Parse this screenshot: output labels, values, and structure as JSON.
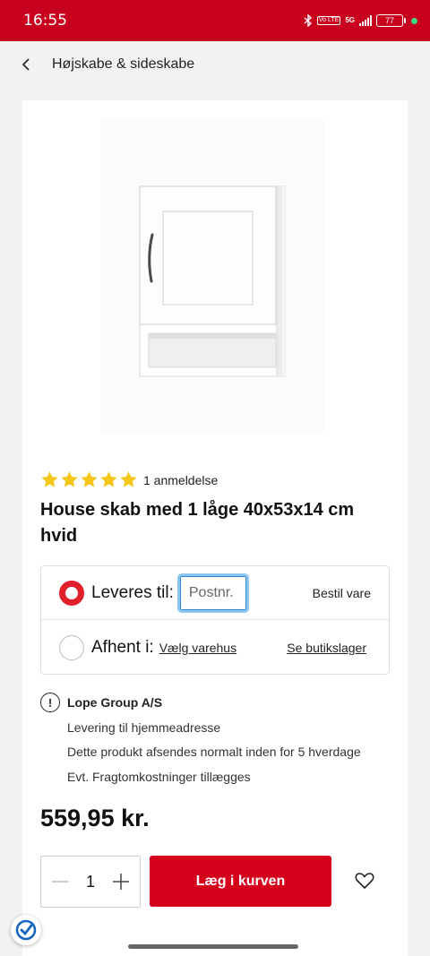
{
  "status_bar": {
    "time": "16:55",
    "volte_label": "Vo LTE",
    "network_label": "5G",
    "battery": "77"
  },
  "nav": {
    "title": "Højskabe & sideskabe",
    "back_icon": "chevron-left-icon"
  },
  "product": {
    "rating_stars": 5,
    "review_count": "1 anmeldelse",
    "title": "House skab med 1 låge 40x53x14 cm hvid"
  },
  "delivery": {
    "deliver_label": "Leveres til:",
    "postnr_placeholder": "Postnr.",
    "postnr_value": "",
    "order_text": "Bestil vare",
    "pickup_label": "Afhent i:",
    "choose_store": "Vælg varehus",
    "store_stock": "Se butikslager"
  },
  "seller": {
    "name": "Lope Group A/S",
    "lines": [
      "Levering til hjemmeadresse",
      "Dette produkt afsendes normalt inden for 5 hverdage",
      "Evt. Fragtomkostninger tillægges"
    ]
  },
  "price": "559,95 kr.",
  "cart": {
    "quantity": "1",
    "add_label": "Læg i kurven"
  },
  "colors": {
    "brand_red": "#c8001e",
    "button_red": "#d4001c",
    "star_yellow": "#f5c518",
    "input_focus": "#8fc6f0"
  }
}
